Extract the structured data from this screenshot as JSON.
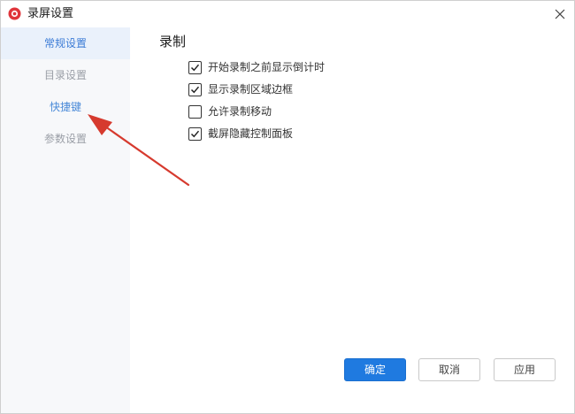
{
  "window": {
    "title": "录屏设置",
    "accent_color": "#e0353b"
  },
  "sidebar": {
    "items": [
      {
        "label": "常规设置",
        "state": "active"
      },
      {
        "label": "目录设置",
        "state": "normal"
      },
      {
        "label": "快捷键",
        "state": "hover"
      },
      {
        "label": "参数设置",
        "state": "normal"
      }
    ],
    "active_color": "#3b7bd6"
  },
  "content": {
    "section_title": "录制",
    "options": [
      {
        "label": "开始录制之前显示倒计时",
        "checked": true
      },
      {
        "label": "显示录制区域边框",
        "checked": true
      },
      {
        "label": "允许录制移动",
        "checked": false
      },
      {
        "label": "截屏隐藏控制面板",
        "checked": true
      }
    ]
  },
  "footer": {
    "confirm_label": "确定",
    "cancel_label": "取消",
    "apply_label": "应用",
    "primary_color": "#1f7ae0"
  },
  "annotation": {
    "arrow_color": "#d63a2e",
    "points_to": "快捷键"
  }
}
